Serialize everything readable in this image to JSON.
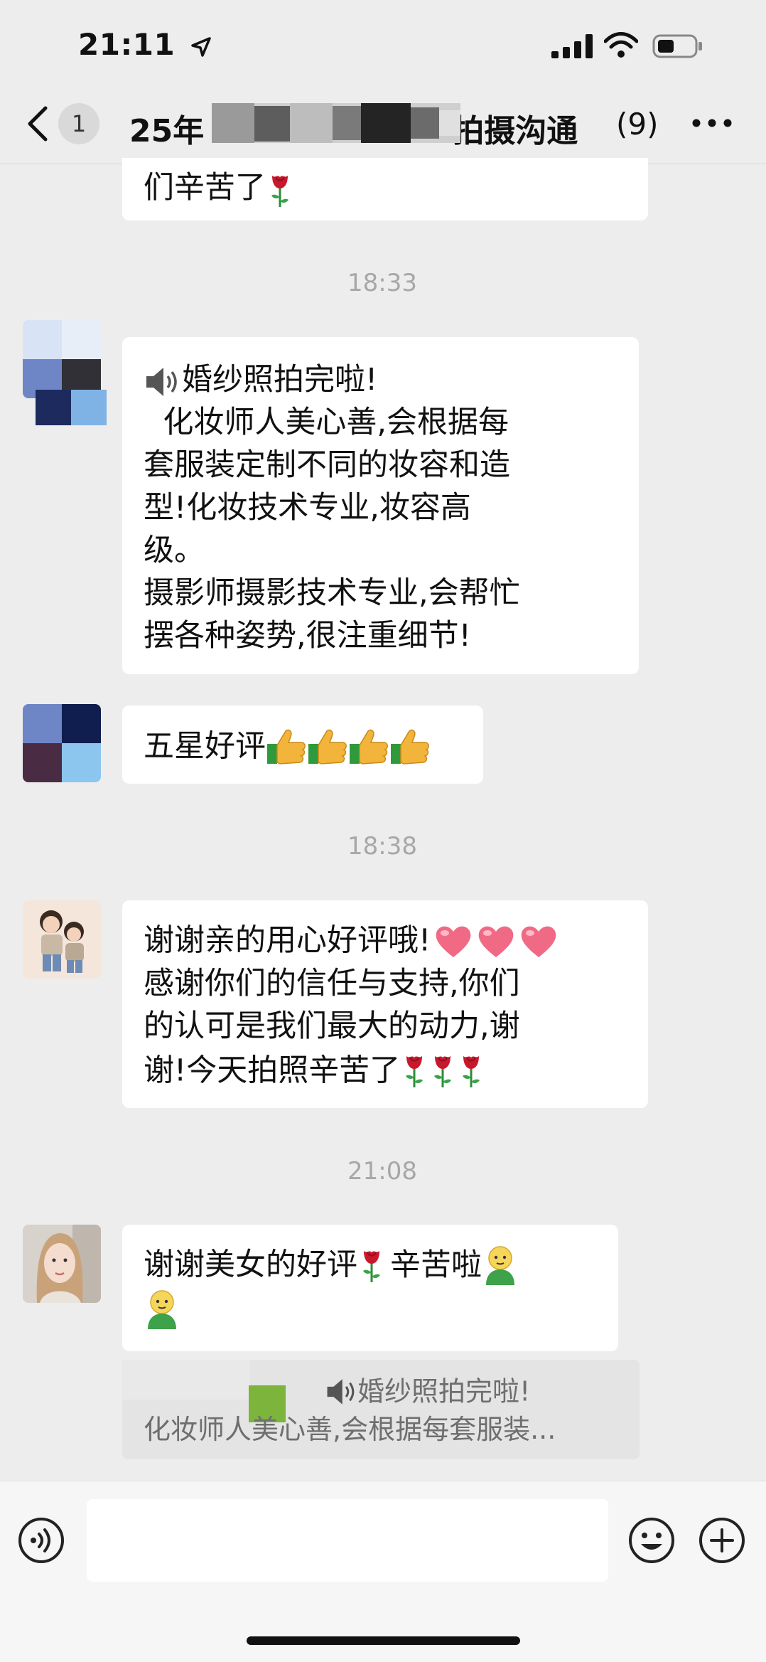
{
  "status_bar": {
    "time": "21:11"
  },
  "nav": {
    "unread_count": "1",
    "title_prefix": "25年",
    "title_suffix": "拍摄沟通",
    "member_count": "(9)"
  },
  "messages": {
    "prev_fragment": "们辛苦了",
    "time_1": "18:33",
    "msg1": {
      "line1": "婚纱照拍完啦!",
      "line2": "  化妆师人美心善,会根据每",
      "line3": "套服装定制不同的妆容和造",
      "line4": "型!化妆技术专业,妆容高",
      "line5": "级。",
      "line6": "摄影师摄影技术专业,会帮忙",
      "line7": "摆各种姿势,很注重细节!"
    },
    "msg2": {
      "text": "五星好评"
    },
    "time_2": "18:38",
    "msg3": {
      "line1": "谢谢亲的用心好评哦!",
      "line2": "感谢你们的信任与支持,你们",
      "line3": "的认可是我们最大的动力,谢",
      "line4": "谢!今天拍照辛苦了"
    },
    "time_3": "21:08",
    "msg4": {
      "text_a": "谢谢美女的好评",
      "text_b": "辛苦啦"
    }
  },
  "quote": {
    "line1": "婚纱照拍完啦!",
    "line2": "化妆师人美心善,会根据每套服装..."
  },
  "icons": {
    "back": "chevron-left-icon",
    "more": "more-icon",
    "voice": "voice-icon",
    "emoji": "emoji-icon",
    "add": "plus-icon"
  },
  "colors": {
    "background": "#ededed",
    "bubble": "#ffffff",
    "timestamp": "#a7a7a7",
    "input_bar": "#f6f6f6"
  }
}
